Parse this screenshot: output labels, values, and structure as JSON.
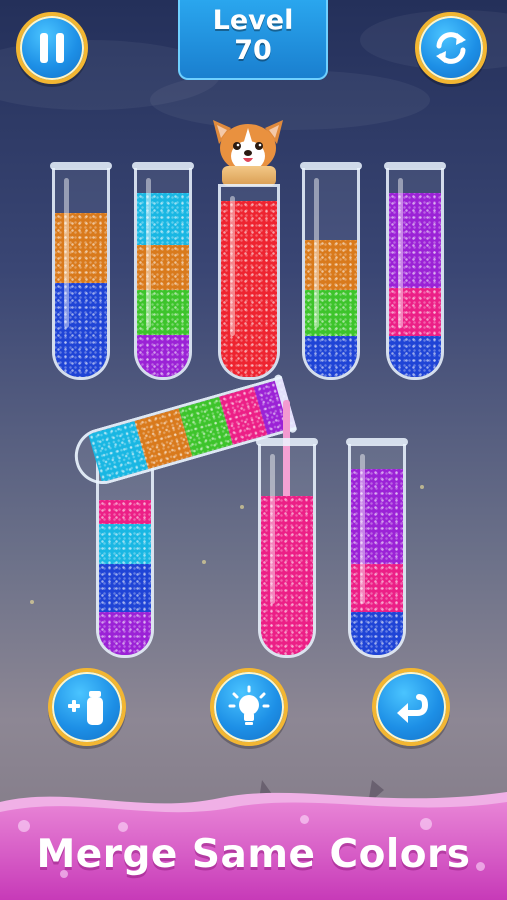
{
  "level": {
    "label": "Level",
    "number": "70"
  },
  "buttons": {
    "pause": {
      "icon": "pause-icon"
    },
    "restart": {
      "icon": "refresh-icon"
    },
    "add_tube": {
      "icon": "plus-tube-icon",
      "text": "+1"
    },
    "hint": {
      "icon": "lightbulb-icon"
    },
    "undo": {
      "icon": "undo-icon"
    }
  },
  "tubes": [
    {
      "id": 1,
      "layers": [
        "blue",
        "orange"
      ],
      "capped": false
    },
    {
      "id": 2,
      "layers": [
        "purple",
        "green",
        "orange",
        "cyan"
      ],
      "capped": false
    },
    {
      "id": 3,
      "layers": [
        "red"
      ],
      "capped": true,
      "mascot": "corgi-icon"
    },
    {
      "id": 4,
      "layers": [
        "blue",
        "green",
        "orange"
      ],
      "capped": false
    },
    {
      "id": 5,
      "layers": [
        "blue",
        "pink",
        "purple"
      ],
      "capped": false
    },
    {
      "id": 6,
      "layers": [
        "purple",
        "blue",
        "cyan",
        "orange",
        "green",
        "pink"
      ],
      "tilted": true,
      "pouring": "pink"
    },
    {
      "id": 7,
      "layers": [
        "pink"
      ],
      "capped": false
    },
    {
      "id": 8,
      "layers": [
        "blue",
        "pink",
        "purple"
      ],
      "capped": false
    }
  ],
  "colors": {
    "blue": "#1f44d6",
    "orange": "#d97a1c",
    "cyan": "#19b7e3",
    "green": "#3dc42b",
    "purple": "#9b22d6",
    "red": "#ee2430",
    "pink": "#ec1f86",
    "accent_gold": "#f2b632",
    "button_blue": "#1d8fe6"
  },
  "slogan": "Merge Same Colors"
}
